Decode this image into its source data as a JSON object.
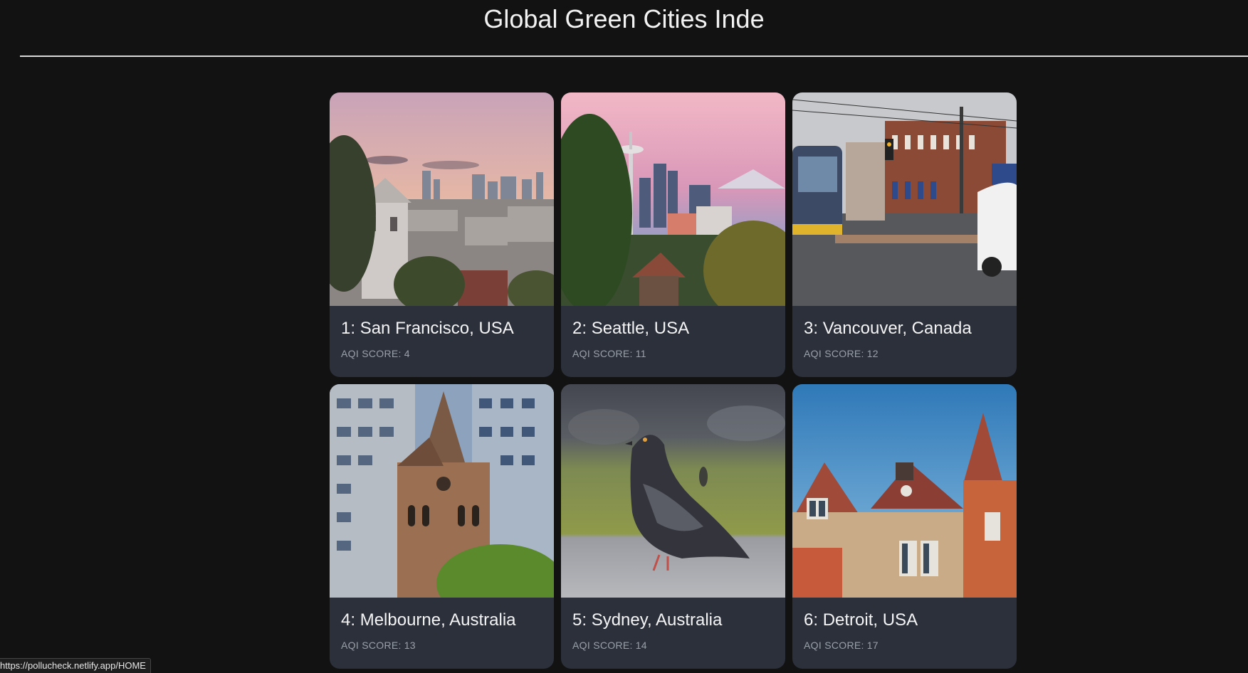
{
  "page": {
    "title": "Global Green Cities Inde"
  },
  "cities": [
    {
      "rank": "1",
      "name": "San Francisco, USA",
      "aqi_label": "AQI SCORE:",
      "aqi": "4",
      "image": "san-francisco-skyline-photo"
    },
    {
      "rank": "2",
      "name": "Seattle, USA",
      "aqi_label": "AQI SCORE:",
      "aqi": "11",
      "image": "seattle-space-needle-photo"
    },
    {
      "rank": "3",
      "name": "Vancouver, Canada",
      "aqi_label": "AQI SCORE:",
      "aqi": "12",
      "image": "vancouver-street-photo"
    },
    {
      "rank": "4",
      "name": "Melbourne, Australia",
      "aqi_label": "AQI SCORE:",
      "aqi": "13",
      "image": "melbourne-church-photo"
    },
    {
      "rank": "5",
      "name": "Sydney, Australia",
      "aqi_label": "AQI SCORE:",
      "aqi": "14",
      "image": "sydney-pigeon-photo"
    },
    {
      "rank": "6",
      "name": "Detroit, USA",
      "aqi_label": "AQI SCORE:",
      "aqi": "17",
      "image": "detroit-house-photo"
    }
  ],
  "status_bar": {
    "url": "https://pollucheck.netlify.app/HOME"
  }
}
